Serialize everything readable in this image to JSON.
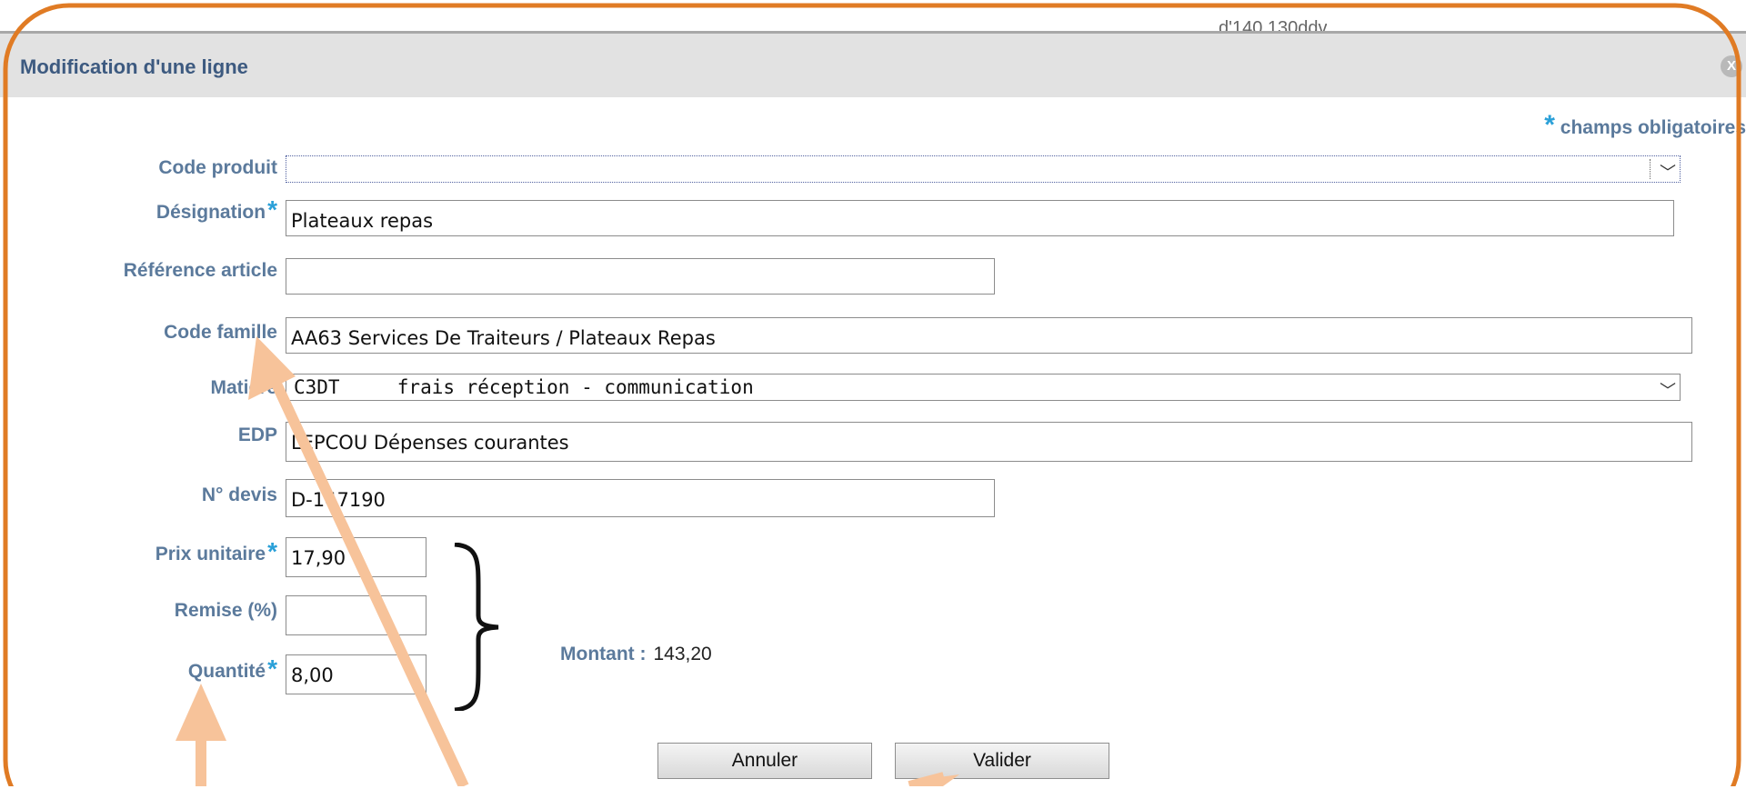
{
  "background": {
    "partial_text": "d'140.130ddv"
  },
  "dialog": {
    "title": "Modification d'une ligne",
    "close_icon_glyph": "X",
    "required_note": {
      "star": "*",
      "text": "champs obligatoires"
    }
  },
  "form": {
    "code_produit": {
      "label": "Code produit",
      "value": ""
    },
    "designation": {
      "label": "Désignation",
      "value": "Plateaux repas"
    },
    "reference_article": {
      "label": "Référence article",
      "value": ""
    },
    "code_famille": {
      "label": "Code famille",
      "value": "AA63 Services De Traiteurs / Plateaux Repas"
    },
    "matiere": {
      "label": "Matière",
      "value": "C3DT     frais réception - communication"
    },
    "edp": {
      "label": "EDP",
      "value": "LEPCOU Dépenses courantes"
    },
    "no_devis": {
      "label": "N° devis",
      "value": "D-147190"
    },
    "prix_unitaire": {
      "label": "Prix unitaire",
      "value": "17,90"
    },
    "remise": {
      "label": "Remise (%)",
      "value": ""
    },
    "quantite": {
      "label": "Quantité",
      "value": "8,00"
    },
    "star": "*"
  },
  "montant": {
    "label": "Montant :",
    "value": "143,20"
  },
  "buttons": {
    "cancel": "Annuler",
    "validate": "Valider"
  },
  "colors": {
    "annotation_frame": "#e07b24",
    "annotation_arrow": "#f7c39a",
    "label_blue": "#5b7a9c",
    "required_star": "#2aa0d8"
  }
}
